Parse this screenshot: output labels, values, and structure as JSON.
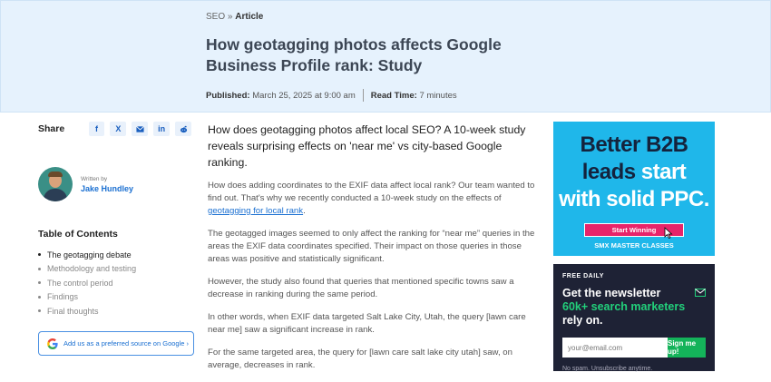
{
  "breadcrumb": {
    "section": "SEO",
    "separator": "»",
    "current": "Article"
  },
  "article": {
    "title": "How geotagging photos affects Google Business Profile rank: Study",
    "published_label": "Published:",
    "published_value": "March 25, 2025 at 9:00 am",
    "read_time_label": "Read Time:",
    "read_time_value": "7 minutes",
    "lead": "How does geotagging photos affect local SEO? A 10-week study reveals surprising effects on 'near me' vs city-based Google ranking.",
    "p1_text": "How does adding coordinates to the EXIF data affect local rank? Our team wanted to find out. That's why we recently conducted a 10-week study on the effects of ",
    "p1_link": "geotagging for local rank",
    "p1_end": ".",
    "p2": "The geotagged images seemed to only affect the ranking for “near me” queries in the areas the EXIF data coordinates specified. Their impact on those queries in those areas was positive and statistically significant.",
    "p3": "However, the study also found that queries that mentioned specific towns saw a decrease in ranking during the same period.",
    "p4": "In other words, when EXIF data targeted Salt Lake City, Utah, the query [lawn care near me] saw a significant increase in rank.",
    "p5": "For the same targeted area, the query for [lawn care salt lake city utah] saw, on average, decreases in rank."
  },
  "share": {
    "label": "Share",
    "buttons": [
      {
        "icon": "facebook-icon",
        "glyph": "f"
      },
      {
        "icon": "x-icon",
        "glyph": "X"
      },
      {
        "icon": "email-icon"
      },
      {
        "icon": "linkedin-icon",
        "glyph": "in"
      },
      {
        "icon": "reddit-icon"
      }
    ]
  },
  "author": {
    "written_by": "Written by",
    "name": "Jake Hundley"
  },
  "toc": {
    "title": "Table of Contents",
    "items": [
      "The geotagging debate",
      "Methodology and testing",
      "The control period",
      "Findings",
      "Final thoughts"
    ]
  },
  "google_source": {
    "label": "Add us as a preferred source on Google ›"
  },
  "ad": {
    "line1": "Better B2B",
    "line2a": "leads",
    "line2b": "start",
    "line3": "with solid PPC.",
    "cta": "Start Winning",
    "brand": "SMX MASTER CLASSES",
    "colors": {
      "background": "#1fb7ea",
      "dark_text": "#14233d",
      "cta": "#e8246a"
    }
  },
  "newsletter": {
    "tag": "FREE DAILY",
    "head1": "Get the newsletter",
    "head2": "60k+ search marketers",
    "head3": "rely on.",
    "placeholder": "your@email.com",
    "button": "Sign me up!",
    "footer": "No spam. Unsubscribe anytime.",
    "colors": {
      "background": "#1e2235",
      "accent": "#22d07b",
      "button": "#14b35a"
    }
  }
}
